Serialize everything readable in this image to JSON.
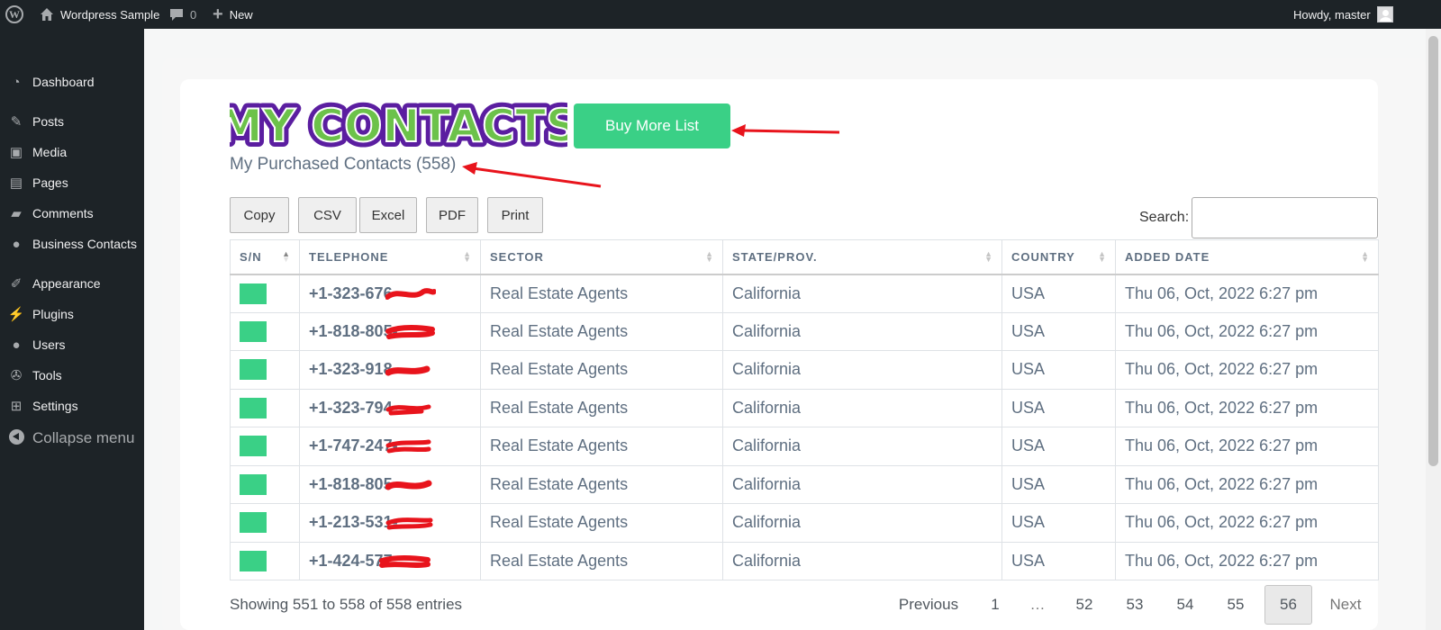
{
  "adminbar": {
    "site_name": "Wordpress Sample",
    "comments_count": "0",
    "new_label": "New",
    "greeting": "Howdy, master"
  },
  "sidebar": {
    "items": [
      {
        "label": "Dashboard",
        "icon": "dashboard-icon"
      },
      {
        "label": "Posts",
        "icon": "pin-icon"
      },
      {
        "label": "Media",
        "icon": "media-icon"
      },
      {
        "label": "Pages",
        "icon": "pages-icon"
      },
      {
        "label": "Comments",
        "icon": "comment-icon"
      },
      {
        "label": "Business Contacts",
        "icon": "groups-icon"
      },
      {
        "label": "Appearance",
        "icon": "brush-icon"
      },
      {
        "label": "Plugins",
        "icon": "plugin-icon"
      },
      {
        "label": "Users",
        "icon": "user-icon"
      },
      {
        "label": "Tools",
        "icon": "wrench-icon"
      },
      {
        "label": "Settings",
        "icon": "settings-icon"
      }
    ],
    "collapse_label": "Collapse menu"
  },
  "page": {
    "logo_text": "MY CONTACTS",
    "buy_button": "Buy More List",
    "purchased_title": "My Purchased Contacts (558)",
    "export_buttons": [
      "Copy",
      "CSV",
      "Excel",
      "PDF",
      "Print"
    ],
    "search_label": "Search:",
    "search_value": ""
  },
  "table": {
    "headers": [
      "S/N",
      "TELEPHONE",
      "SECTOR",
      "STATE/PROV.",
      "COUNTRY",
      "ADDED DATE"
    ],
    "rows": [
      {
        "telephone": "+1-323-676-",
        "sector": "Real Estate Agents",
        "state": "California",
        "country": "USA",
        "date": "Thu 06, Oct, 2022 6:27 pm"
      },
      {
        "telephone": "+1-818-805-",
        "sector": "Real Estate Agents",
        "state": "California",
        "country": "USA",
        "date": "Thu 06, Oct, 2022 6:27 pm"
      },
      {
        "telephone": "+1-323-918-",
        "sector": "Real Estate Agents",
        "state": "California",
        "country": "USA",
        "date": "Thu 06, Oct, 2022 6:27 pm"
      },
      {
        "telephone": "+1-323-794-",
        "sector": "Real Estate Agents",
        "state": "California",
        "country": "USA",
        "date": "Thu 06, Oct, 2022 6:27 pm"
      },
      {
        "telephone": "+1-747-247-",
        "sector": "Real Estate Agents",
        "state": "California",
        "country": "USA",
        "date": "Thu 06, Oct, 2022 6:27 pm"
      },
      {
        "telephone": "+1-818-805-",
        "sector": "Real Estate Agents",
        "state": "California",
        "country": "USA",
        "date": "Thu 06, Oct, 2022 6:27 pm"
      },
      {
        "telephone": "+1-213-531-",
        "sector": "Real Estate Agents",
        "state": "California",
        "country": "USA",
        "date": "Thu 06, Oct, 2022 6:27 pm"
      },
      {
        "telephone": "+1-424-577",
        "sector": "Real Estate Agents",
        "state": "California",
        "country": "USA",
        "date": "Thu 06, Oct, 2022 6:27 pm"
      }
    ]
  },
  "footer": {
    "info": "Showing 551 to 558 of 558 entries",
    "previous": "Previous",
    "pages": [
      "1",
      "…",
      "52",
      "53",
      "54",
      "55",
      "56"
    ],
    "current_page": "56",
    "next": "Next"
  },
  "colors": {
    "accent_green": "#3ad086",
    "admin_bar": "#1d2327",
    "annotation_red": "#e8141c",
    "logo_purple": "#5b1ea0",
    "logo_green": "#6cc24a"
  }
}
